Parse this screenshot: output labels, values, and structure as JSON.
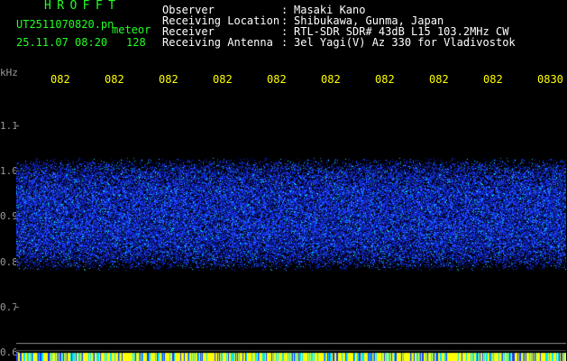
{
  "header": {
    "brand": "HROFFT",
    "file_name": "UT2511070820.pn",
    "file_tag": "meteor",
    "date_time": "25.11.07 08:20",
    "count": "128"
  },
  "meta": [
    {
      "label": "Observer",
      "value": "Masaki Kano"
    },
    {
      "label": "Receiving Location",
      "value": "Shibukawa, Gunma, Japan"
    },
    {
      "label": "Receiver",
      "value": "RTL-SDR SDR# 43dB L15 103.2MHz CW"
    },
    {
      "label": "Receiving Antenna",
      "value": "3el Yagi(V) Az 330 for Vladivostok"
    }
  ],
  "colors": {
    "background": "#000000",
    "header_green": "#22ff22",
    "time_labels": "#ffff00",
    "axis_gray": "#9a9a9a",
    "signal_blue": "#1a3cff",
    "signal_cyan": "#00e5ff",
    "bottom_bar_yellow": "#ffff00"
  },
  "chart_data": {
    "type": "heatmap",
    "ylabel": "kHz",
    "x_tick_labels": [
      "082",
      "082",
      "082",
      "082",
      "082",
      "082",
      "082",
      "082",
      "082",
      "0830"
    ],
    "y_tick_labels": [
      "1.1",
      "1.0",
      "0.9",
      "0.8",
      "0.7",
      "0.6"
    ],
    "y_ticks": [
      1.1,
      1.0,
      0.9,
      0.8,
      0.7,
      0.6
    ],
    "ylim": [
      0.58,
      1.18
    ],
    "noise_band_khz": [
      0.78,
      1.03
    ],
    "reference_line_khz": 0.62,
    "grid": false
  }
}
